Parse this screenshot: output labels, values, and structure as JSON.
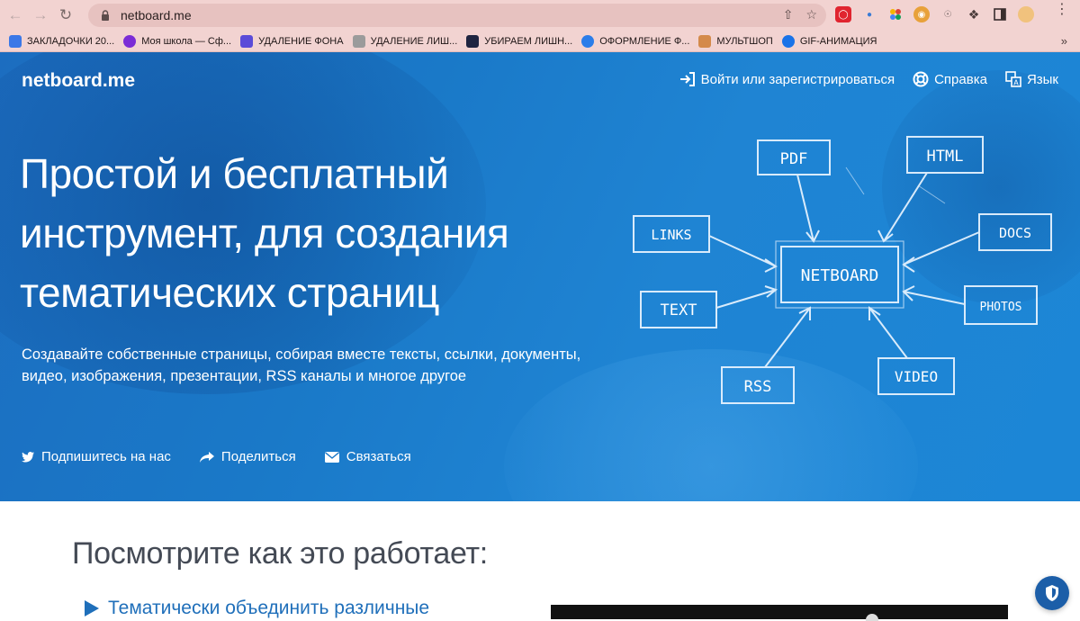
{
  "browser": {
    "url": "netboard.me",
    "bookmarks": [
      {
        "label": "ЗАКЛАДОЧКИ 20...",
        "color": "#3b78e7"
      },
      {
        "label": "Моя школа — Сф...",
        "color": "#7b2cd6"
      },
      {
        "label": "УДАЛЕНИЕ ФОНА",
        "color": "#5b4bd8"
      },
      {
        "label": "УДАЛЕНИЕ ЛИШ...",
        "color": "#6b6b6b"
      },
      {
        "label": "УБИРАЕМ ЛИШН...",
        "color": "#1f2440"
      },
      {
        "label": "ОФОРМЛЕНИЕ Ф...",
        "color": "#2b7de9"
      },
      {
        "label": "МУЛЬТШОП",
        "color": "#d48a4a"
      },
      {
        "label": "GIF-АНИМАЦИЯ",
        "color": "#1a73e8"
      }
    ],
    "bookmarks_more": "»"
  },
  "site": {
    "logo": "netboard.me",
    "nav": {
      "login": "Войти или зарегистрироваться",
      "help": "Справка",
      "language": "Язык"
    },
    "hero": {
      "title_lines": [
        "Простой и бесплатный",
        "инструмент, для создания",
        "тематических страниц"
      ],
      "subtitle_lines": [
        "Создавайте собственные страницы, собирая вместе тексты, ссылки, документы,",
        "видео, изображения, презентации, RSS каналы и многое другое"
      ]
    },
    "social": {
      "follow": "Подпишитесь на нас",
      "share": "Поделиться",
      "contact": "Связаться"
    },
    "diagram": {
      "center": "NETBOARD",
      "nodes": [
        "PDF",
        "HTML",
        "LINKS",
        "DOCS",
        "TEXT",
        "PHOTOS",
        "RSS",
        "VIDEO"
      ]
    },
    "how": {
      "title": "Посмотрите как это работает:",
      "first_feature": "Тематически объединить различные"
    }
  },
  "colors": {
    "hero_blue": "#1a79c8",
    "accent": "#1f6fba",
    "chrome": "#f2d3d1"
  }
}
